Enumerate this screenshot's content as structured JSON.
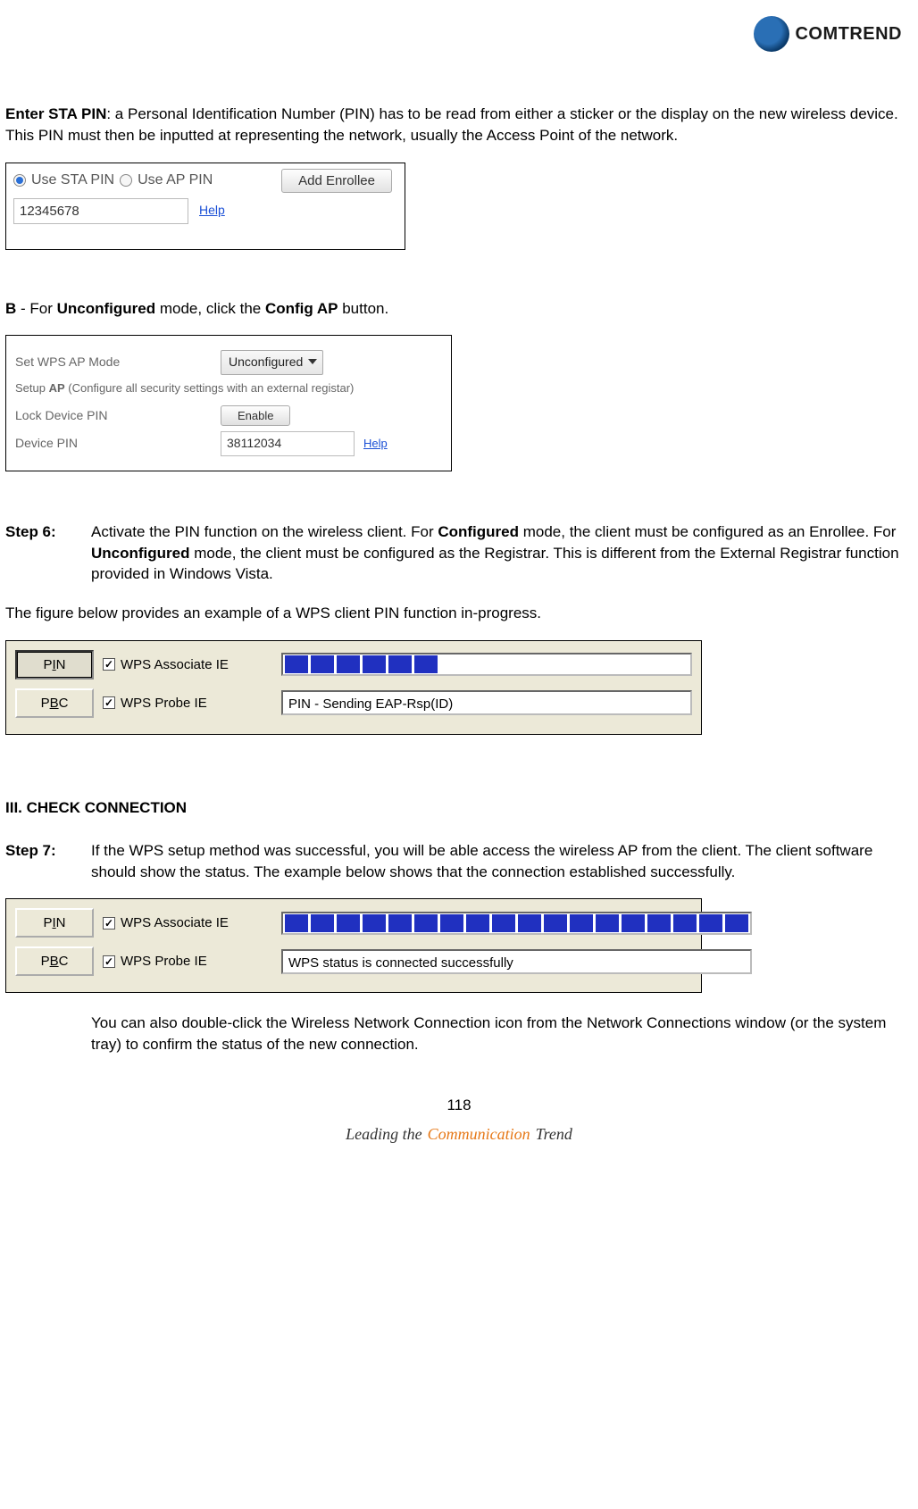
{
  "brand": "COMTREND",
  "para1": {
    "label": "Enter STA PIN",
    "text": ": a Personal Identification Number (PIN) has to be read from either a sticker or the display on the new wireless device. This PIN must then be inputted at representing the network, usually the Access Point of the network."
  },
  "fig1": {
    "sta_label": "Use STA PIN",
    "ap_label": "Use AP PIN",
    "add_btn": "Add Enrollee",
    "pin": "12345678",
    "help": "Help"
  },
  "paraB": {
    "prefix": "B",
    "mid1": " - For ",
    "mode": "Unconfigured",
    "mid2": " mode, click the ",
    "btn": "Config AP",
    "suffix": " button."
  },
  "fig2": {
    "row1_label": "Set WPS AP Mode",
    "row1_value": "Unconfigured",
    "hint_prefix": "Setup ",
    "hint_bold": "AP",
    "hint_suffix": " (Configure all security settings with an external registar)",
    "row2_label": "Lock Device PIN",
    "row2_btn": "Enable",
    "row3_label": "Device PIN",
    "row3_value": "38112034",
    "help": "Help"
  },
  "step6": {
    "label": "Step 6:",
    "t1": "Activate the PIN function on the wireless client.   For ",
    "b1": "Configured",
    "t2": " mode, the client must be configured as an Enrollee.   For ",
    "b2": "Unconfigured",
    "t3": " mode, the client must be configured as the Registrar.   This is different from the External Registrar function provided in Windows Vista."
  },
  "paraMid": "The figure below provides an example of a WPS client PIN function in-progress.",
  "fig3": {
    "pin_btn": "PIN",
    "pbc_btn": "PBC",
    "pin_u": "I",
    "pbc_u": "B",
    "chk1": "WPS Associate IE",
    "chk2": "WPS Probe IE",
    "status": "PIN - Sending EAP-Rsp(ID)",
    "progress_blocks": 6
  },
  "section3": "III. CHECK CONNECTION",
  "step7": {
    "label": "Step 7:",
    "text": "If the WPS setup method was successful, you will be able access the wireless AP from the client.   The client software should show the status. The example below shows that the connection established successfully."
  },
  "fig4": {
    "pin_btn": "PIN",
    "pbc_btn": "PBC",
    "pin_u": "I",
    "pbc_u": "B",
    "chk1": "WPS Associate IE",
    "chk2": "WPS Probe IE",
    "status": "WPS status is connected successfully",
    "progress_blocks": 18
  },
  "tailnote": "You can also double-click the Wireless Network Connection icon from the Network Connections window (or the system tray) to confirm the status of the new connection.",
  "pagenum": "118",
  "footer": {
    "lead": "Leading the",
    "comm": "Communication",
    "trend": "Trend"
  }
}
